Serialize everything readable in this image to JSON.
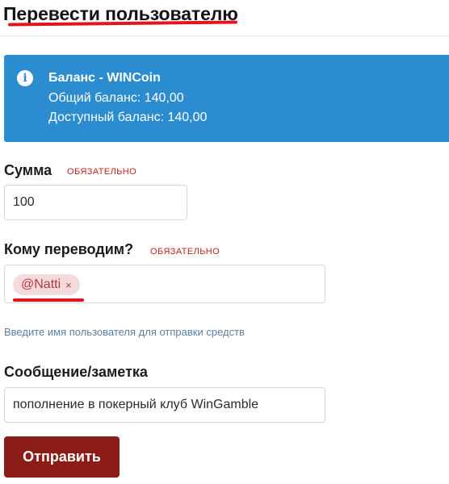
{
  "page_title": "Перевести пользователю",
  "balance_box": {
    "title": "Баланс - WINCoin",
    "total_balance": "Общий баланс: 140,00",
    "available_balance": "Доступный баланс: 140,00",
    "icon": "info-icon",
    "color": "#2b8cd0"
  },
  "amount": {
    "label": "Сумма",
    "required": "ОБЯЗАТЕЛЬНО",
    "value": "100"
  },
  "recipient": {
    "label": "Кому переводим?",
    "required": "ОБЯЗАТЕЛЬНО",
    "tag": "@Natti",
    "tag_close": "×",
    "hint": "Введите имя пользователя для отправки средств"
  },
  "message": {
    "label": "Сообщение/заметка",
    "value": "пополнение в покерный клуб WinGamble"
  },
  "submit_label": "Отправить",
  "colors": {
    "accent": "#8b1d16",
    "required": "#c0241f",
    "highlight": "#e0161b"
  }
}
